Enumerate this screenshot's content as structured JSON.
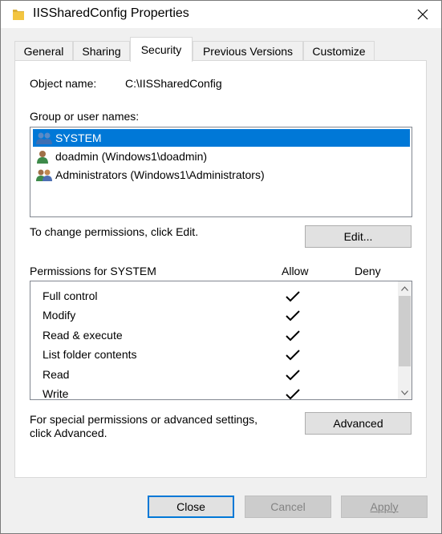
{
  "window": {
    "title": "IISSharedConfig Properties"
  },
  "tabs": [
    {
      "label": "General"
    },
    {
      "label": "Sharing"
    },
    {
      "label": "Security"
    },
    {
      "label": "Previous Versions"
    },
    {
      "label": "Customize"
    }
  ],
  "active_tab": "Security",
  "security": {
    "object_name_label": "Object name:",
    "object_name_value": "C:\\IISSharedConfig",
    "group_label": "Group or user names:",
    "users": [
      {
        "label": "SYSTEM",
        "icon": "users-group-icon",
        "selected": true
      },
      {
        "label": "doadmin (Windows1\\doadmin)",
        "icon": "user-icon",
        "selected": false
      },
      {
        "label": "Administrators (Windows1\\Administrators)",
        "icon": "users-group-icon",
        "selected": false
      }
    ],
    "change_text": "To change permissions, click Edit.",
    "edit_button": "Edit...",
    "permissions_title": "Permissions for SYSTEM",
    "allow_header": "Allow",
    "deny_header": "Deny",
    "permissions": [
      {
        "name": "Full control",
        "allow": true,
        "deny": false
      },
      {
        "name": "Modify",
        "allow": true,
        "deny": false
      },
      {
        "name": "Read & execute",
        "allow": true,
        "deny": false
      },
      {
        "name": "List folder contents",
        "allow": true,
        "deny": false
      },
      {
        "name": "Read",
        "allow": true,
        "deny": false
      },
      {
        "name": "Write",
        "allow": true,
        "deny": false
      }
    ],
    "special_text_line1": "For special permissions or advanced settings,",
    "special_text_line2": "click Advanced.",
    "advanced_button": "Advanced"
  },
  "footer": {
    "close_button": "Close",
    "cancel_button": "Cancel",
    "apply_button": "Apply"
  },
  "colors": {
    "selection": "#0078d7",
    "default_button_border": "#0078d7",
    "folder_icon": "#f3c540"
  }
}
